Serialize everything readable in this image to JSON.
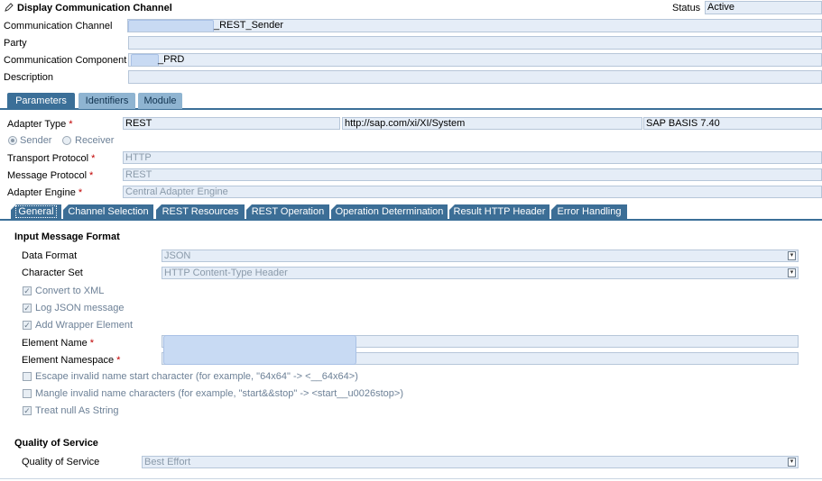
{
  "header": {
    "title": "Display Communication Channel",
    "status_label": "Status",
    "status_value": "Active"
  },
  "main_fields": {
    "channel_label": "Communication Channel",
    "channel_value": "_REST_Sender",
    "party_label": "Party",
    "party_value": "",
    "component_label": "Communication Component",
    "component_value": "_PRD",
    "description_label": "Description",
    "description_value": ""
  },
  "tabs": [
    "Parameters",
    "Identifiers",
    "Module"
  ],
  "params": {
    "adapter_type_label": "Adapter Type",
    "adapter_type": "REST",
    "adapter_ns": "http://sap.com/xi/XI/System",
    "adapter_swc": "SAP BASIS 7.40",
    "sender": "Sender",
    "receiver": "Receiver",
    "transport_label": "Transport Protocol",
    "transport_value": "HTTP",
    "message_label": "Message Protocol",
    "message_value": "REST",
    "engine_label": "Adapter Engine",
    "engine_value": "Central Adapter Engine"
  },
  "subtabs": [
    "General",
    "Channel Selection",
    "REST Resources",
    "REST Operation",
    "Operation Determination",
    "Result HTTP Header",
    "Error Handling"
  ],
  "general": {
    "section_input": "Input Message Format",
    "data_format_label": "Data Format",
    "data_format_value": "JSON",
    "charset_label": "Character Set",
    "charset_value": "HTTP Content-Type Header",
    "convert_xml": "Convert to XML",
    "log_json": "Log JSON message",
    "add_wrapper": "Add Wrapper Element",
    "element_name_label": "Element Name",
    "element_ns_label": "Element Namespace",
    "escape_invalid": "Escape invalid name start character (for example, \"64x64\" -> <__64x64>)",
    "mangle_invalid": "Mangle invalid name characters (for example, \"start&&stop\" -> <start__u0026stop>)",
    "treat_null": "Treat null As String",
    "section_qos": "Quality of Service",
    "qos_label": "Quality of Service",
    "qos_value": "Best Effort"
  }
}
